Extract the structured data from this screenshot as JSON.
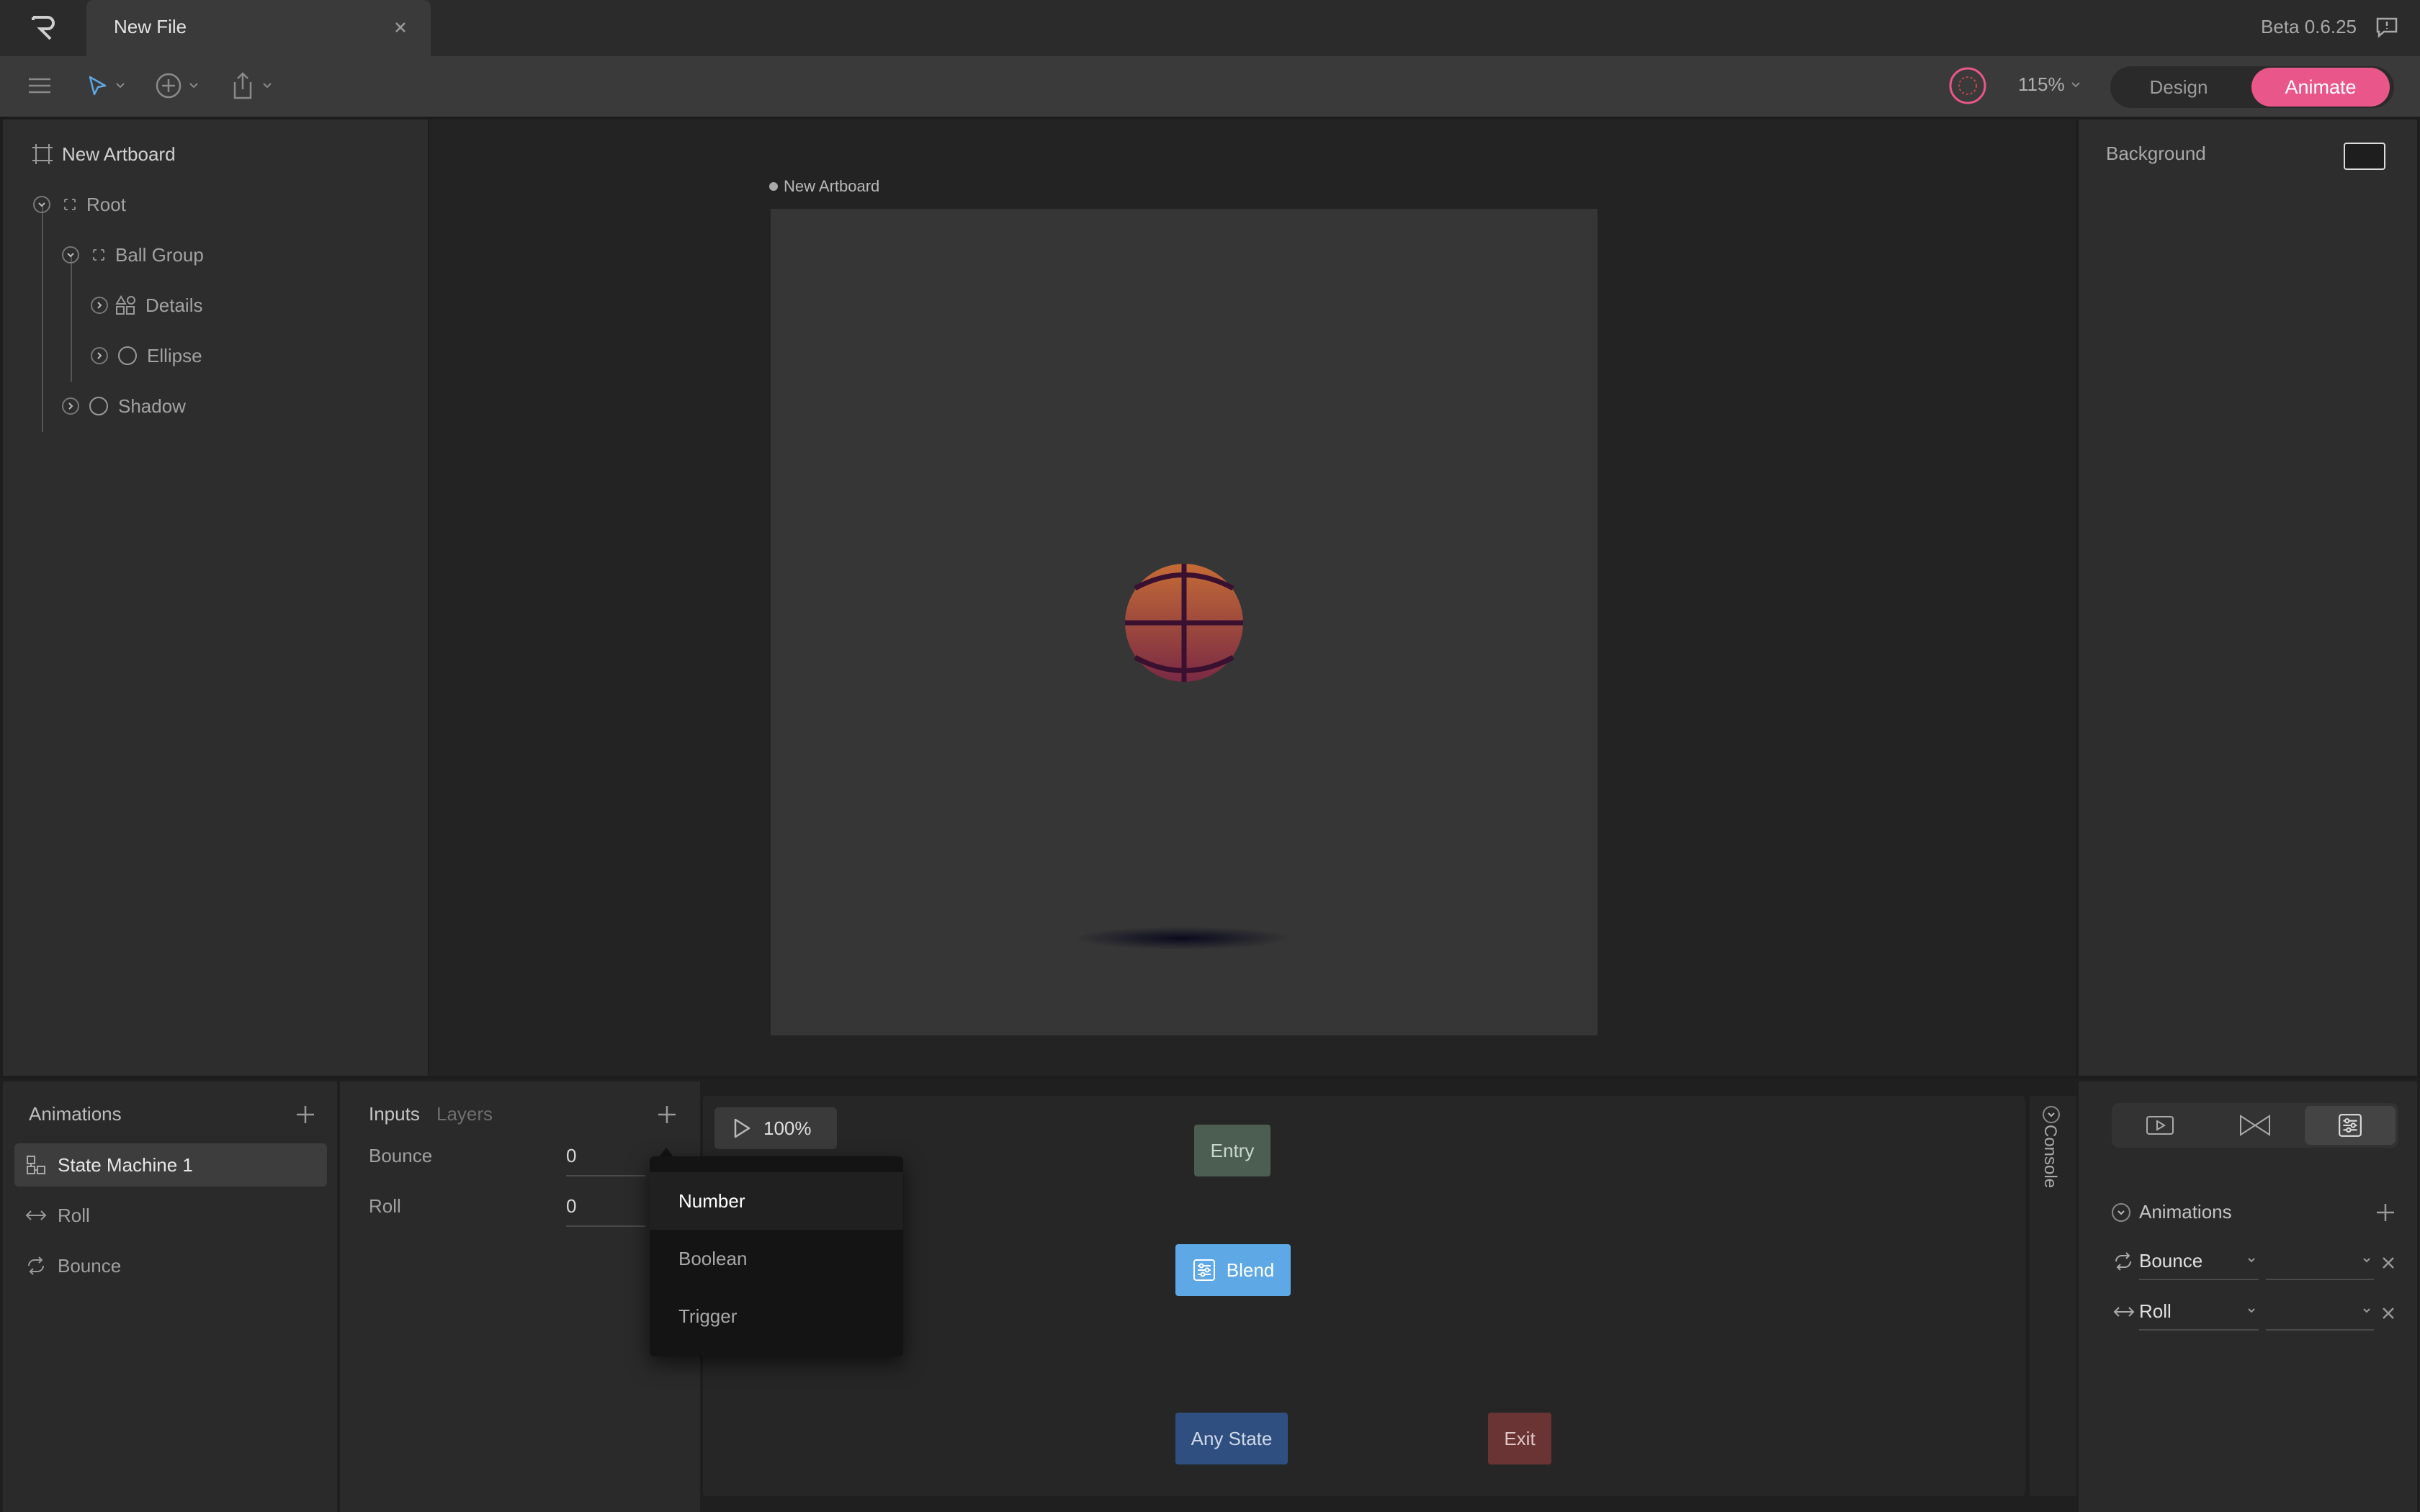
{
  "app": {
    "tab_title": "New File",
    "version": "Beta 0.6.25"
  },
  "toolbar": {
    "zoom": "115%",
    "design_label": "Design",
    "animate_label": "Animate"
  },
  "hierarchy": {
    "artboard": "New Artboard",
    "items": [
      {
        "label": "Root"
      },
      {
        "label": "Ball Group"
      },
      {
        "label": "Details"
      },
      {
        "label": "Ellipse"
      },
      {
        "label": "Shadow"
      }
    ]
  },
  "canvas": {
    "artboard_label": "New Artboard"
  },
  "inspector": {
    "background_label": "Background"
  },
  "animations_panel": {
    "title": "Animations",
    "items": [
      {
        "label": "State Machine 1"
      },
      {
        "label": "Roll"
      },
      {
        "label": "Bounce"
      }
    ]
  },
  "inputs_panel": {
    "inputs_tab": "Inputs",
    "layers_tab": "Layers",
    "inputs": [
      {
        "label": "Bounce",
        "value": "0"
      },
      {
        "label": "Roll",
        "value": "0"
      }
    ]
  },
  "graph": {
    "playback_speed": "100%",
    "nodes": {
      "entry": "Entry",
      "blend": "Blend",
      "any_state": "Any State",
      "exit": "Exit"
    }
  },
  "dropdown": {
    "options": [
      "Number",
      "Boolean",
      "Trigger"
    ]
  },
  "console": {
    "label": "Console"
  },
  "blend_panel": {
    "title": "Animations",
    "rows": [
      {
        "label": "Bounce"
      },
      {
        "label": "Roll"
      }
    ]
  },
  "colors": {
    "accent": "#e9578a",
    "blend_node": "#5ea8e6",
    "entry_node": "#4c5e52",
    "any_state_node": "#2f4f80",
    "exit_node": "#6a3434"
  }
}
